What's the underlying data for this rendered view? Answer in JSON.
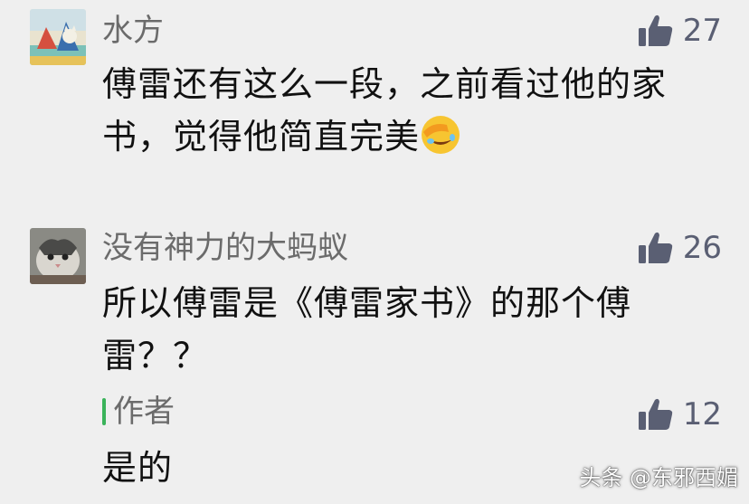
{
  "comments": [
    {
      "author": "水方",
      "likes": "27",
      "text": "傅雷还有这么一段，之前看过他的家书，觉得他简直完美",
      "emoji": "facepalm-laugh-emoji"
    },
    {
      "author": "没有神力的大蚂蚁",
      "likes": "26",
      "text": "所以傅雷是《傅雷家书》的那个傅雷？？",
      "reply": {
        "author": "作者",
        "likes": "12",
        "text": "是的"
      }
    }
  ],
  "watermark": {
    "text": "头条 @东邪西媚"
  },
  "colors": {
    "background": "#efefef",
    "name": "#6b6b6b",
    "like": "#5a5f73",
    "reply_bar": "#3ab35a"
  }
}
